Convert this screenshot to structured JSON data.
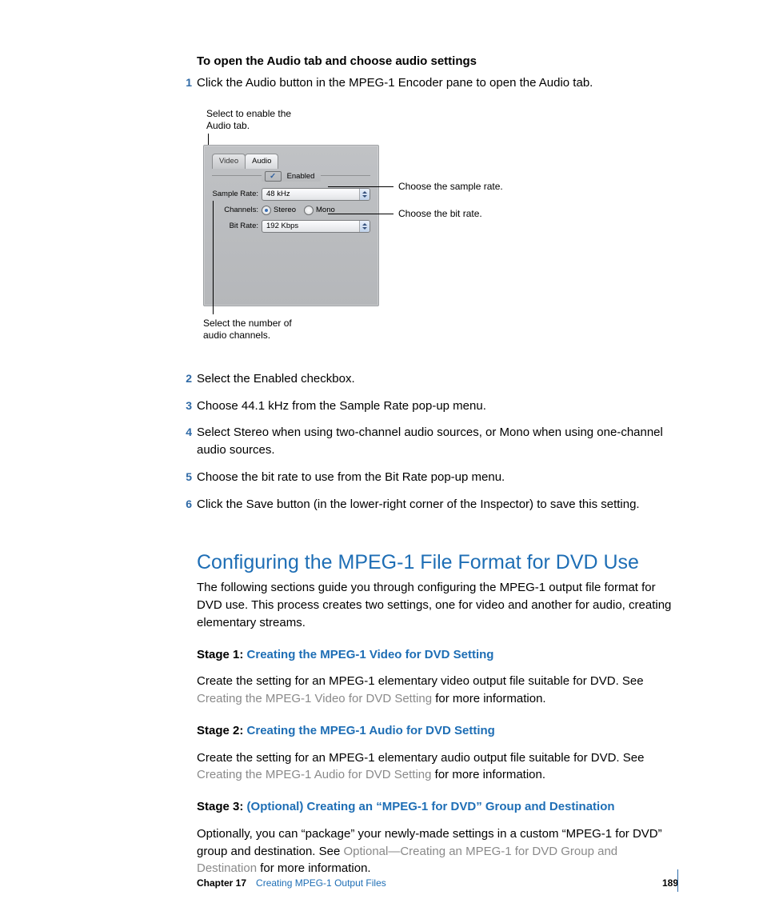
{
  "task_heading": "To open the Audio tab and choose audio settings",
  "steps": [
    "Click the Audio button in the MPEG-1 Encoder pane to open the Audio tab.",
    "Select the Enabled checkbox.",
    "Choose 44.1 kHz from the Sample Rate pop-up menu.",
    "Select Stereo when using two-channel audio sources, or Mono when using one-channel audio sources.",
    "Choose the bit rate to use from the Bit Rate pop-up menu.",
    "Click the Save button (in the lower-right corner of the Inspector) to save this setting."
  ],
  "callouts": {
    "enable": "Select to enable the Audio tab.",
    "sample": "Choose the sample rate.",
    "bitrate": "Choose the bit rate.",
    "channels": "Select the number of audio channels."
  },
  "panel": {
    "tabs": {
      "video": "Video",
      "audio": "Audio"
    },
    "enabled_label": "Enabled",
    "sample_label": "Sample Rate:",
    "sample_value": "48 kHz",
    "channels_label": "Channels:",
    "stereo": "Stereo",
    "mono": "Mono",
    "bitrate_label": "Bit Rate:",
    "bitrate_value": "192 Kbps"
  },
  "section": {
    "title": "Configuring the MPEG-1 File Format for DVD Use",
    "intro": "The following sections guide you through configuring the MPEG-1 output file format for DVD use. This process creates two settings, one for video and another for audio, creating elementary streams.",
    "stage1_prefix": "Stage 1: ",
    "stage1_link": "Creating the MPEG-1 Video for DVD Setting",
    "stage1_body_a": "Create the setting for an MPEG-1 elementary video output file suitable for DVD. See ",
    "stage1_xref": "Creating the MPEG-1 Video for DVD Setting",
    "stage1_body_b": " for more information.",
    "stage2_prefix": "Stage 2: ",
    "stage2_link": "Creating the MPEG-1 Audio for DVD Setting",
    "stage2_body_a": "Create the setting for an MPEG-1 elementary audio output file suitable for DVD. See ",
    "stage2_xref": "Creating the MPEG-1 Audio for DVD Setting",
    "stage2_body_b": " for more information.",
    "stage3_prefix": "Stage 3: ",
    "stage3_link": "(Optional) Creating an “MPEG-1 for DVD” Group and Destination",
    "stage3_body_a": "Optionally, you can “package” your newly-made settings in a custom “MPEG-1 for DVD” group and destination. See ",
    "stage3_xref": "Optional—Creating an MPEG-1 for DVD Group and Destination",
    "stage3_body_b": " for more information."
  },
  "footer": {
    "chapter": "Chapter 17",
    "title": "Creating MPEG-1 Output Files",
    "page": "189"
  }
}
